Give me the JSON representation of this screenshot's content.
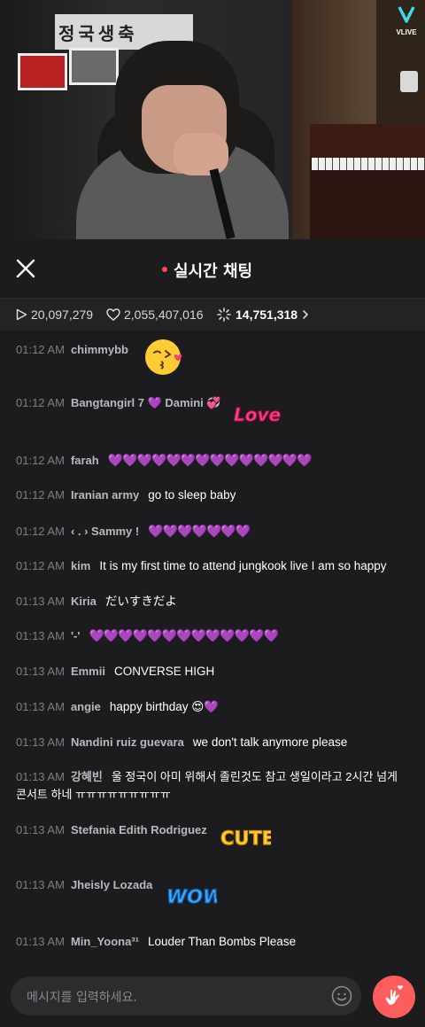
{
  "video": {
    "poster_text": "정국생축",
    "brand": "VLIVE"
  },
  "header": {
    "title": "실시간 채팅"
  },
  "stats": {
    "plays": "20,097,279",
    "hearts": "2,055,407,016",
    "sparkle": "14,751,318"
  },
  "messages": [
    {
      "time": "01:12 AM",
      "user": "chimmybb",
      "text": "",
      "sticker": "kiss-emoji-sticker"
    },
    {
      "time": "01:12 AM",
      "user": "Bangtangirl 7 💜 Damini 💞",
      "text": "",
      "sticker": "love-sticker",
      "sticker_text": "Love"
    },
    {
      "time": "01:12 AM",
      "user": "farah",
      "text": "💜💜💜💜💜💜💜💜💜💜💜💜💜💜"
    },
    {
      "time": "01:12 AM",
      "user": "Iranian army",
      "text": "go to sleep baby"
    },
    {
      "time": "01:12 AM",
      "user": "‹ . › Sammy !",
      "text": "💜💜💜💜💜💜💜"
    },
    {
      "time": "01:12 AM",
      "user": "kim",
      "text": "It is my first time to attend jungkook live I am so happy"
    },
    {
      "time": "01:13 AM",
      "user": "Kiria",
      "text": "だいすきだよ"
    },
    {
      "time": "01:13 AM",
      "user": "'-'",
      "text": "💜💜💜💜💜💜💜💜💜💜💜💜💜"
    },
    {
      "time": "01:13 AM",
      "user": "Emmii",
      "text": "CONVERSE HIGH"
    },
    {
      "time": "01:13 AM",
      "user": "angie",
      "text": "happy birthday 😍💜"
    },
    {
      "time": "01:13 AM",
      "user": "Nandini ruiz guevara",
      "text": "we don't talk anymore please"
    },
    {
      "time": "01:13 AM",
      "user": "강혜빈",
      "text": "울 정국이 아미 위해서 졸린것도 참고 생일이라고 2시간 넘게 콘서트 하네 ㅠㅠㅠㅠㅠㅠㅠㅠㅠ"
    },
    {
      "time": "01:13 AM",
      "user": "Stefania Edith Rodriguez",
      "text": "",
      "sticker": "cute-sticker",
      "sticker_text": "CUTE"
    },
    {
      "time": "01:13 AM",
      "user": "Jheisly Lozada",
      "text": "",
      "sticker": "wow-sticker",
      "sticker_text": "WOW"
    },
    {
      "time": "01:13 AM",
      "user": "Min_Yoona³¹",
      "text": "Louder Than Bombs Please"
    }
  ],
  "input": {
    "placeholder": "메시지를 입력하세요."
  },
  "colors": {
    "background": "#1c1c1e",
    "accent_red": "#ff4a4a",
    "heart_button": "#ff5c5c",
    "purple_heart": "#9b30ff"
  }
}
